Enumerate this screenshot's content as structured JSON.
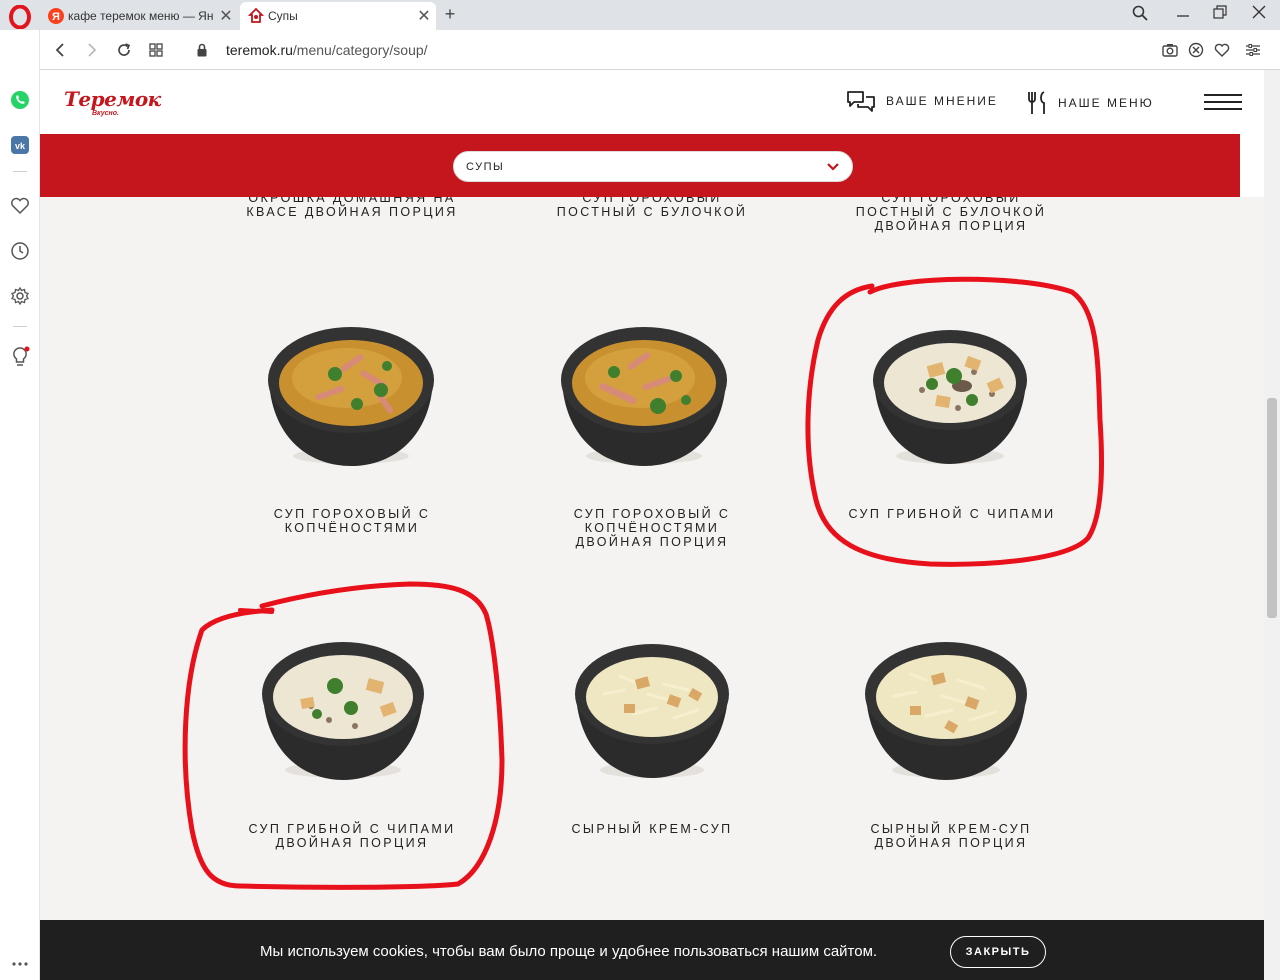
{
  "browser": {
    "tabs": [
      {
        "title": "кафе теремок меню — Ян",
        "favicon": "yandex-icon",
        "favicon_letter": "Я",
        "active": false
      },
      {
        "title": "Супы",
        "favicon": "teremok-icon",
        "active": true
      }
    ],
    "new_tab": "+",
    "url_host": "teremok.ru",
    "url_path": "/menu/category/soup/",
    "sidebar_icons": [
      "whatsapp-icon",
      "vk-icon",
      "heart-icon",
      "history-icon",
      "settings-icon",
      "lightbulb-icon",
      "more-icon"
    ],
    "vk_label": "vk"
  },
  "site": {
    "logo_text": "Теремок",
    "logo_sub": "Вкусно.",
    "nav_feedback": "ВАШЕ МНЕНИЕ",
    "nav_menu": "НАШЕ МЕНЮ",
    "category_select": "СУПЫ",
    "brand_color": "#c4161c"
  },
  "menu_items": [
    {
      "name": "ОКРОШКА ДОМАШНЯЯ НА КВАСЕ ДВОЙНАЯ ПОРЦИЯ",
      "lines": [
        "ОКРОШКА ДОМАШНЯЯ НА",
        "КВАСЕ ДВОЙНАЯ ПОРЦИЯ"
      ],
      "partially_visible": true
    },
    {
      "name": "СУП ГОРОХОВЫЙ ПОСТНЫЙ С БУЛОЧКОЙ",
      "lines": [
        "СУП ГОРОХОВЫЙ",
        "ПОСТНЫЙ С БУЛОЧКОЙ"
      ],
      "partially_visible": true
    },
    {
      "name": "СУП ГОРОХОВЫЙ ПОСТНЫЙ С БУЛОЧКОЙ ДВОЙНАЯ ПОРЦИЯ",
      "lines": [
        "СУП ГОРОХОВЫЙ",
        "ПОСТНЫЙ С БУЛОЧКОЙ",
        "ДВОЙНАЯ ПОРЦИЯ"
      ],
      "partially_visible": true
    },
    {
      "name": "СУП ГОРОХОВЫЙ С КОПЧЁНОСТЯМИ",
      "lines": [
        "СУП ГОРОХОВЫЙ С",
        "КОПЧЁНОСТЯМИ"
      ],
      "soup": "pea"
    },
    {
      "name": "СУП ГОРОХОВЫЙ С КОПЧЁНОСТЯМИ ДВОЙНАЯ ПОРЦИЯ",
      "lines": [
        "СУП ГОРОХОВЫЙ С",
        "КОПЧЁНОСТЯМИ",
        "ДВОЙНАЯ ПОРЦИЯ"
      ],
      "soup": "pea"
    },
    {
      "name": "СУП ГРИБНОЙ С ЧИПАМИ",
      "lines": [
        "СУП ГРИБНОЙ С ЧИПАМИ"
      ],
      "soup": "mushroom",
      "circled": true
    },
    {
      "name": "СУП ГРИБНОЙ С ЧИПАМИ ДВОЙНАЯ ПОРЦИЯ",
      "lines": [
        "СУП ГРИБНОЙ С ЧИПАМИ",
        "ДВОЙНАЯ ПОРЦИЯ"
      ],
      "soup": "mushroom",
      "circled": true
    },
    {
      "name": "СЫРНЫЙ КРЕМ-СУП",
      "lines": [
        "СЫРНЫЙ КРЕМ-СУП"
      ],
      "soup": "cheese"
    },
    {
      "name": "СЫРНЫЙ КРЕМ-СУП ДВОЙНАЯ ПОРЦИЯ",
      "lines": [
        "СЫРНЫЙ КРЕМ-СУП",
        "ДВОЙНАЯ ПОРЦИЯ"
      ],
      "soup": "cheese"
    }
  ],
  "cookie_banner": {
    "text": "Мы используем cookies, чтобы вам было проще и удобнее пользоваться нашим сайтом.",
    "button": "ЗАКРЫТЬ"
  },
  "annotation_color": "#e8101a"
}
